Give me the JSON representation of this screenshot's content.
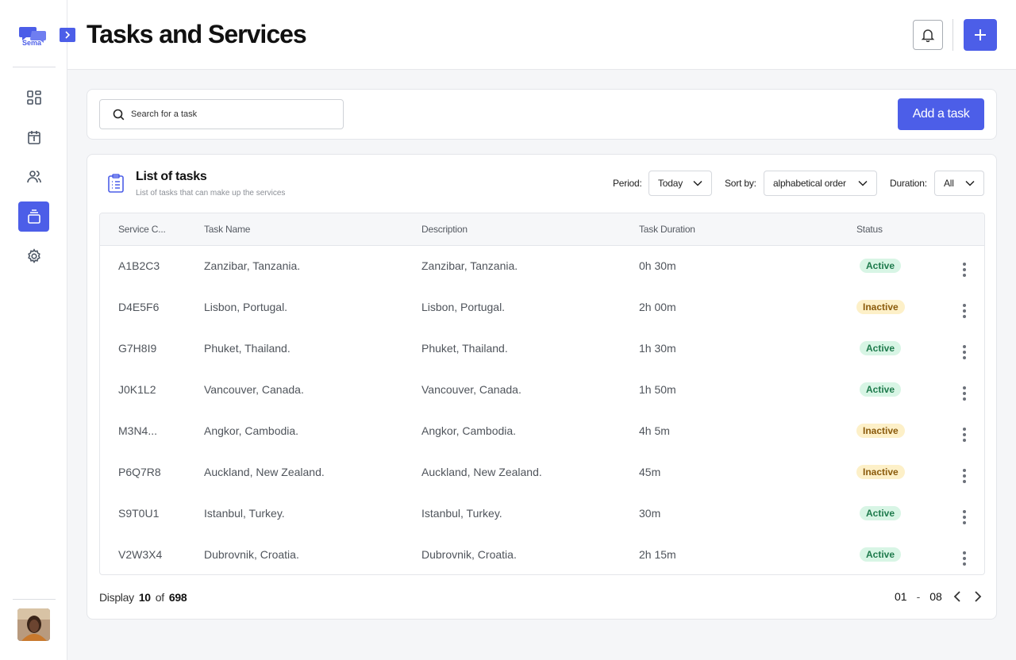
{
  "brand": {
    "name": "Sema",
    "color": "#4c5ee8"
  },
  "sidebar": {
    "items": [
      {
        "name": "dashboard",
        "icon": "grid-icon"
      },
      {
        "name": "calendar",
        "icon": "calendar-icon"
      },
      {
        "name": "users",
        "icon": "users-icon"
      },
      {
        "name": "tasks",
        "icon": "layers-icon",
        "active": true
      },
      {
        "name": "settings",
        "icon": "gear-icon"
      }
    ]
  },
  "header": {
    "title": "Tasks and Services"
  },
  "search": {
    "placeholder": "Search for a task"
  },
  "actions": {
    "add_task_label": "Add a task"
  },
  "list": {
    "title": "List of tasks",
    "subtitle": "List of tasks that can make up the services",
    "filters": {
      "period_label": "Period:",
      "period_value": "Today",
      "sort_label": "Sort by:",
      "sort_value": "alphabetical order",
      "duration_label": "Duration:",
      "duration_value": "All"
    },
    "columns": [
      "Service C...",
      "Task Name",
      "Description",
      "Task Duration",
      "Status"
    ],
    "rows": [
      {
        "code": "A1B2C3",
        "name": "Zanzibar, Tanzania.",
        "description": "Zanzibar, Tanzania.",
        "duration": "0h 30m",
        "status": "Active"
      },
      {
        "code": "D4E5F6",
        "name": "Lisbon, Portugal.",
        "description": "Lisbon, Portugal.",
        "duration": "2h 00m",
        "status": "Inactive"
      },
      {
        "code": "G7H8I9",
        "name": "Phuket, Thailand.",
        "description": "Phuket, Thailand.",
        "duration": "1h 30m",
        "status": "Active"
      },
      {
        "code": "J0K1L2",
        "name": "Vancouver, Canada.",
        "description": "Vancouver, Canada.",
        "duration": "1h 50m",
        "status": "Active"
      },
      {
        "code": "M3N4...",
        "name": "Angkor, Cambodia.",
        "description": "Angkor, Cambodia.",
        "duration": "4h 5m",
        "status": "Inactive"
      },
      {
        "code": "P6Q7R8",
        "name": "Auckland, New Zealand.",
        "description": "Auckland, New Zealand.",
        "duration": "45m",
        "status": "Inactive"
      },
      {
        "code": "S9T0U1",
        "name": "Istanbul, Turkey.",
        "description": "Istanbul, Turkey.",
        "duration": "30m",
        "status": "Active"
      },
      {
        "code": "V2W3X4",
        "name": "Dubrovnik, Croatia.",
        "description": "Dubrovnik, Croatia.",
        "duration": "2h 15m",
        "status": "Active"
      }
    ]
  },
  "footer": {
    "display_label": "Display",
    "display_count": "10",
    "of_label": "of",
    "total": "698",
    "page_from": "01",
    "page_sep": "-",
    "page_to": "08"
  }
}
